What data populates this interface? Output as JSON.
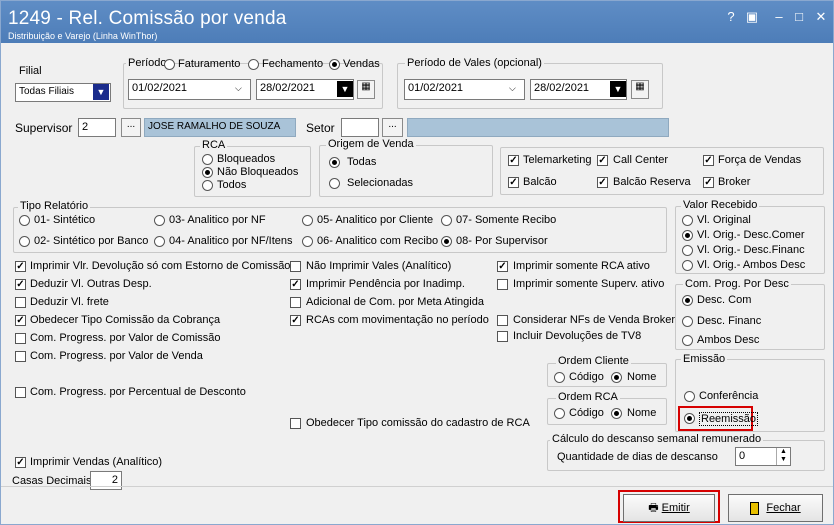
{
  "window": {
    "title": "1249 - Rel. Comissão por venda",
    "subtitle": "Distribuição e Varejo (Linha WinThor)",
    "controls": [
      "?",
      "▣",
      "–",
      "□",
      "✕"
    ]
  },
  "filial": {
    "label": "Filial",
    "value": "Todas Filiais"
  },
  "periodo": {
    "label": "Período:",
    "options": [
      "Faturamento",
      "Fechamento",
      "Vendas"
    ],
    "selected": "Vendas",
    "from": "01/02/2021",
    "to": "28/02/2021"
  },
  "periodo_vales": {
    "label": "Período de Vales (opcional)",
    "from": "01/02/2021",
    "to": "28/02/2021"
  },
  "supervisor": {
    "label": "Supervisor",
    "code": "2",
    "name": "JOSE RAMALHO DE SOUZA",
    "lookup": "..."
  },
  "setor": {
    "label": "Setor",
    "code": "",
    "name": "",
    "lookup": "..."
  },
  "rca": {
    "label": "RCA",
    "options": [
      "Bloqueados",
      "Não Bloqueados",
      "Todos"
    ],
    "selected": "Não Bloqueados"
  },
  "origem": {
    "label": "Origem de Venda",
    "options": [
      "Todas",
      "Selecionadas"
    ],
    "selected": "Todas",
    "checks": [
      [
        "Telemarketing",
        "Call Center",
        "Força de Vendas"
      ],
      [
        "Balcão",
        "Balcão Reserva",
        "Broker"
      ]
    ]
  },
  "tipo_relatorio": {
    "label": "Tipo Relatório",
    "row1": [
      "01- Sintético",
      "03- Analitico por NF",
      "05- Analitico por Cliente",
      "07- Somente Recibo"
    ],
    "row2": [
      "02- Sintético por Banco",
      "04- Analitico por NF/Itens",
      "06- Analitico com Recibo",
      "08- Por Supervisor"
    ],
    "selected": "08- Por Supervisor"
  },
  "valor_recebido": {
    "label": "Valor Recebido",
    "options": [
      "Vl. Original",
      "Vl. Orig.- Desc.Comer",
      "Vl. Orig.- Desc.Financ",
      "Vl. Orig.- Ambos Desc"
    ],
    "selected": "Vl. Orig.- Desc.Comer"
  },
  "checks_col1": [
    "Imprimir Vlr. Devolução só com Estorno de Comissão",
    "Deduzir Vl. Outras Desp.",
    "Deduzir Vl. frete",
    "Obedecer Tipo Comissão da Cobrança",
    "Com. Progress. por Valor de Comissão",
    "Com. Progress. por Valor de Venda",
    "Com. Progress. por Percentual de Desconto"
  ],
  "checks_col2": [
    "Não Imprimir Vales (Analítico)",
    "Imprimir Pendência por Inadimp.",
    "Adicional de Com. por Meta Atingida",
    "RCAs com movimentação no período"
  ],
  "checks_col3": [
    "Imprimir somente RCA ativo",
    "Imprimir somente Superv. ativo",
    "Considerar NFs de Venda Broker",
    "Incluir Devoluções de TV8"
  ],
  "obedecer_tipo": "Obedecer Tipo comissão do cadastro de RCA",
  "com_prog_desc": {
    "label": "Com. Prog. Por Desc",
    "options": [
      "Desc. Com",
      "Desc. Financ",
      "Ambos Desc"
    ],
    "selected": "Desc. Com"
  },
  "ordem_cliente": {
    "label": "Ordem Cliente",
    "options": [
      "Código",
      "Nome"
    ],
    "selected": "Nome"
  },
  "ordem_rca": {
    "label": "Ordem RCA",
    "options": [
      "Código",
      "Nome"
    ],
    "selected": "Nome"
  },
  "emissao": {
    "label": "Emissão",
    "options": [
      "Conferência",
      "Reemissão"
    ],
    "selected": "Reemissão"
  },
  "descanso": {
    "label": "Cálculo do descanso semanal remunerado",
    "qty_label": "Quantidade de dias de descanso",
    "value": "0"
  },
  "imprimir_vendas": "Imprimir Vendas (Analítico)",
  "casas": {
    "label": "Casas Decimais",
    "value": "2"
  },
  "buttons": {
    "emitir": "Emitir",
    "fechar": "Fechar"
  },
  "colors": {
    "titlebar": "#5a89c2",
    "highlight": "#d60000",
    "readonly": "#a9c3d8"
  }
}
